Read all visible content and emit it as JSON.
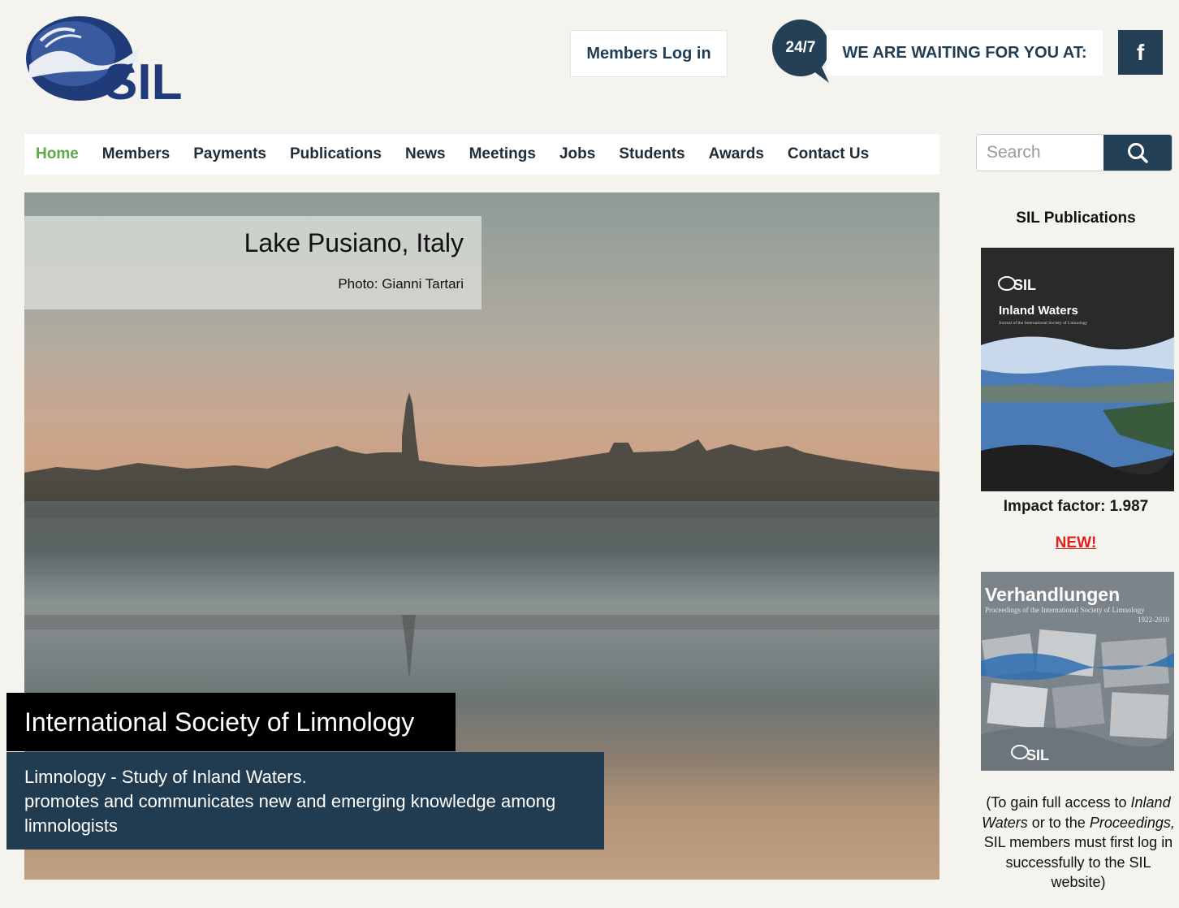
{
  "header": {
    "logo_text": "SIL",
    "members_login": "Members Log in",
    "badge_247": "24/7",
    "waiting_text": "WE ARE WAITING FOR YOU AT:",
    "facebook_icon": "f"
  },
  "nav": {
    "items": [
      "Home",
      "Members",
      "Payments",
      "Publications",
      "News",
      "Meetings",
      "Jobs",
      "Students",
      "Awards",
      "Contact Us"
    ],
    "active": "Home"
  },
  "search": {
    "placeholder": "Search",
    "icon": "search-icon"
  },
  "hero": {
    "caption_title": "Lake Pusiano, Italy",
    "caption_credit": "Photo: Gianni Tartari",
    "org_name": "International Society of Limnology",
    "tagline_line1": "Limnology - Study of Inland Waters.",
    "tagline_line2": "promotes and communicates new and emerging knowledge among limnologists"
  },
  "sidebar": {
    "title": "SIL Publications",
    "journal1_title": "Inland Waters",
    "journal1_subtitle": "Journal of the International Society of Limnology",
    "journal1_logo": "SIL",
    "impact_factor": "Impact factor: 1.987",
    "new_label": "NEW!",
    "journal2_title": "Verhandlungen",
    "journal2_subtitle": "Proceedings of the International Society of Limnology",
    "journal2_years": "1922-2010",
    "journal2_logo": "SIL",
    "access_prefix": "(To gain full access to",
    "access_iw": "Inland Waters",
    "access_mid": "or to the",
    "access_proc": "Proceedings,",
    "access_rest": "SIL members must first log in successfully to the SIL website)"
  },
  "colors": {
    "navy": "#234056",
    "active_nav": "#5fa94b",
    "new_red": "#e0201c"
  }
}
